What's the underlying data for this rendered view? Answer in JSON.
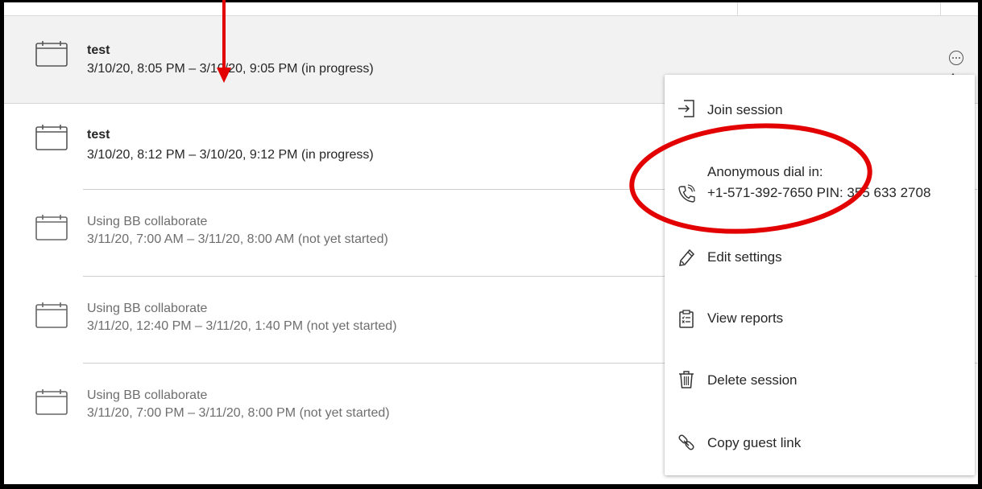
{
  "sessions": [
    {
      "title": "test",
      "time": "3/10/20, 8:05 PM – 3/10/20, 9:05 PM (in progress)"
    },
    {
      "title": "test",
      "time": "3/10/20, 8:12 PM – 3/10/20, 9:12 PM (in progress)"
    },
    {
      "title": "Using BB collaborate",
      "time": "3/11/20, 7:00 AM – 3/11/20, 8:00 AM (not yet started)"
    },
    {
      "title": "Using BB collaborate",
      "time": "3/11/20, 12:40 PM – 3/11/20, 1:40 PM (not yet started)"
    },
    {
      "title": "Using BB collaborate",
      "time": "3/11/20, 7:00 PM – 3/11/20, 8:00 PM (not yet started)"
    }
  ],
  "menu": {
    "join": "Join session",
    "dial_title": "Anonymous dial in:",
    "dial_number": "+1-571-392-7650 PIN: 355 633 2708",
    "edit": "Edit settings",
    "reports": "View reports",
    "delete": "Delete session",
    "copy": "Copy guest link"
  },
  "colors": {
    "annotation": "#e30000",
    "active_row_bg": "#f2f2f2"
  },
  "icons": [
    "calendar-icon",
    "more-options-icon",
    "join-session-icon",
    "phone-icon",
    "pencil-icon",
    "clipboard-icon",
    "trash-icon",
    "link-icon"
  ]
}
